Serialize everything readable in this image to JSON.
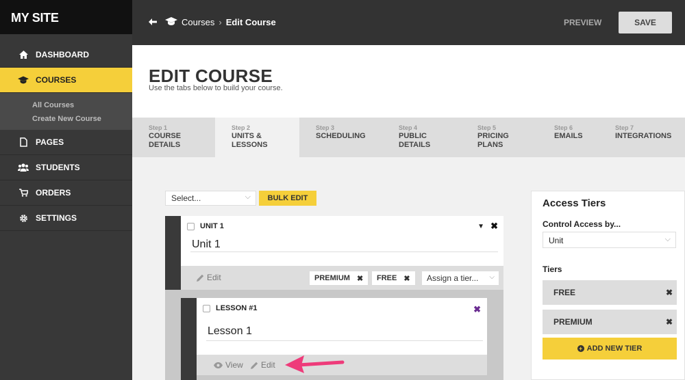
{
  "brand": "MY SITE",
  "sidebar": {
    "items": [
      {
        "label": "DASHBOARD",
        "icon": "home-icon"
      },
      {
        "label": "COURSES",
        "icon": "graduation-cap-icon"
      },
      {
        "label": "PAGES",
        "icon": "page-icon"
      },
      {
        "label": "STUDENTS",
        "icon": "users-icon"
      },
      {
        "label": "ORDERS",
        "icon": "cart-icon"
      },
      {
        "label": "SETTINGS",
        "icon": "gear-icon"
      }
    ],
    "subitems": [
      "All Courses",
      "Create New Course"
    ],
    "accent": "#f5cf3a"
  },
  "topbar": {
    "crumb_parent": "Courses",
    "crumb_current": "Edit Course",
    "preview_label": "PREVIEW",
    "save_label": "SAVE"
  },
  "header": {
    "title": "EDIT COURSE",
    "subtitle": "Use the tabs below to build your course."
  },
  "tabs": [
    {
      "step": "Step 1",
      "label1": "COURSE",
      "label2": "DETAILS"
    },
    {
      "step": "Step 2",
      "label1": "UNITS &",
      "label2": "LESSONS"
    },
    {
      "step": "Step 3",
      "label1": "SCHEDULING",
      "label2": ""
    },
    {
      "step": "Step 4",
      "label1": "PUBLIC",
      "label2": "DETAILS"
    },
    {
      "step": "Step 5",
      "label1": "PRICING",
      "label2": "PLANS"
    },
    {
      "step": "Step 6",
      "label1": "EMAILS",
      "label2": ""
    },
    {
      "step": "Step 7",
      "label1": "INTEGRATIONS",
      "label2": ""
    }
  ],
  "bulk": {
    "select_value": "Select...",
    "button": "BULK EDIT"
  },
  "unit": {
    "label": "UNIT 1",
    "name": "Unit 1",
    "edit": "Edit",
    "tags": [
      "PREMIUM",
      "FREE"
    ],
    "assign": "Assign a tier..."
  },
  "lesson": {
    "label": "LESSON #1",
    "name": "Lesson 1",
    "view": "View",
    "edit": "Edit"
  },
  "panel": {
    "title": "Access Tiers",
    "control_label": "Control Access by...",
    "control_value": "Unit",
    "tiers_label": "Tiers",
    "tiers": [
      "FREE",
      "PREMIUM"
    ],
    "add_button": "ADD NEW TIER"
  }
}
